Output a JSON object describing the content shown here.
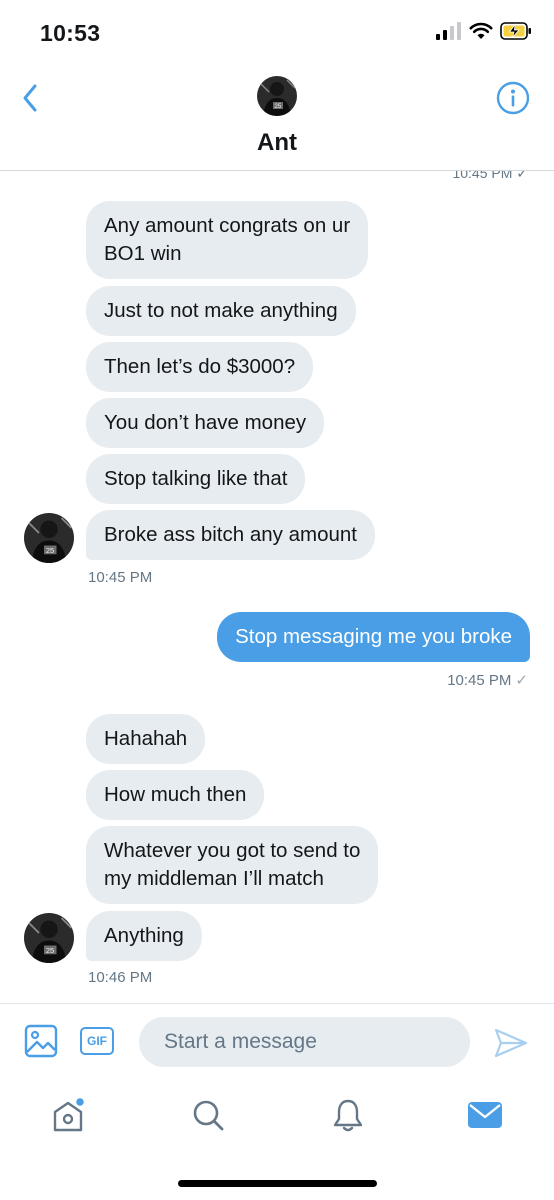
{
  "status_bar": {
    "time": "10:53",
    "battery_color": "#f4d03f"
  },
  "header": {
    "contact_name": "Ant"
  },
  "conversation": {
    "top_cut_stamp": "10:45 PM ✓",
    "group1": {
      "messages": [
        "Any amount congrats on ur\nBO1 win",
        "Just to not make anything",
        "Then let’s do $3000?",
        "You don’t have money",
        "Stop talking like that",
        "Broke ass bitch any amount"
      ],
      "timestamp": "10:45 PM"
    },
    "outgoing": {
      "message": "Stop messaging me you broke",
      "timestamp": "10:45 PM",
      "status": "✓"
    },
    "group2": {
      "messages": [
        "Hahahah",
        "How much then",
        "Whatever you got to send to\nmy middleman I’ll match",
        "Anything"
      ],
      "timestamp": "10:46 PM"
    }
  },
  "composer": {
    "gif_label": "GIF",
    "placeholder": "Start a message"
  },
  "colors": {
    "accent": "#4a9ee6",
    "incoming_bubble": "#e6ecf0",
    "muted_text": "#657786"
  },
  "tabbar": {
    "icons": [
      "home-icon",
      "search-icon",
      "notifications-icon",
      "messages-icon"
    ],
    "active": "messages-icon",
    "home_has_unread_dot": true
  }
}
